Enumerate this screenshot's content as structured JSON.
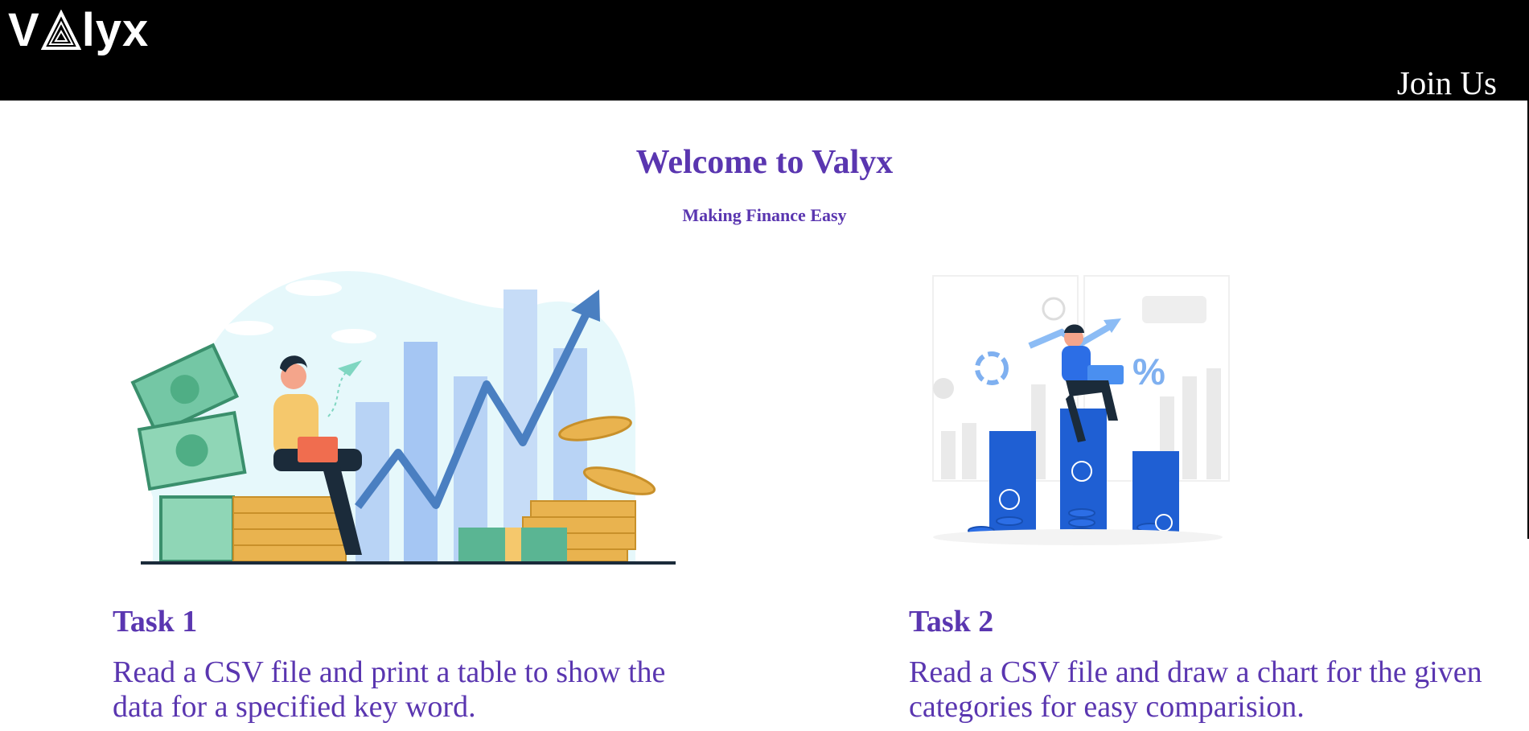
{
  "header": {
    "logo_text_start": "V",
    "logo_text_end": "lyx",
    "join_label": "Join Us"
  },
  "hero": {
    "title": "Welcome to Valyx",
    "subtitle": "Making Finance Easy"
  },
  "tasks": [
    {
      "title": "Task 1",
      "description": "Read a CSV file and print a table to show the data for a specified key word.",
      "illustration": "person-on-coins-chart-illustration"
    },
    {
      "title": "Task 2",
      "description": "Read a CSV file and draw a chart for the given categories for easy comparision.",
      "illustration": "person-on-bar-chart-illustration"
    }
  ],
  "colors": {
    "header_bg": "#000000",
    "accent_purple": "#5a36b0",
    "text_light": "#ffffff"
  }
}
